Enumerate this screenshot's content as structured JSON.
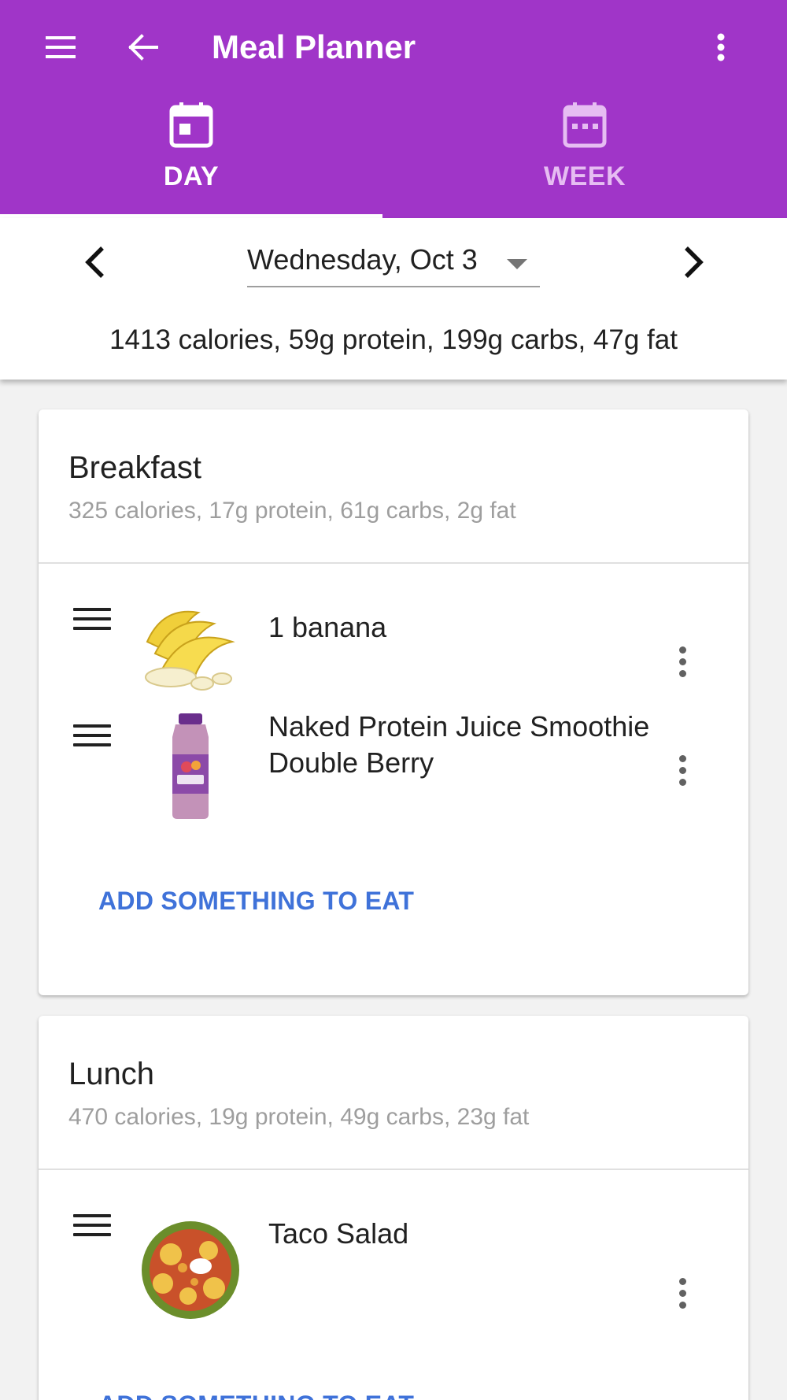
{
  "app_bar": {
    "title": "Meal Planner",
    "accent_color": "#a035c8"
  },
  "tabs": [
    {
      "label": "DAY",
      "icon": "calendar-day-icon",
      "selected": true
    },
    {
      "label": "WEEK",
      "icon": "calendar-week-icon",
      "selected": false
    }
  ],
  "date_nav": {
    "date": "Wednesday, Oct 3",
    "totals": "1413 calories, 59g protein, 199g carbs, 47g fat"
  },
  "meals": [
    {
      "title": "Breakfast",
      "totals": "325 calories, 17g protein, 61g carbs, 2g fat",
      "items": [
        {
          "name": "1 banana",
          "image": "banana"
        },
        {
          "name": "Naked Protein Juice Smoothie Double Berry",
          "image": "smoothie-bottle"
        }
      ],
      "add_label": "ADD SOMETHING TO EAT"
    },
    {
      "title": "Lunch",
      "totals": "470 calories, 19g protein, 49g carbs, 23g fat",
      "items": [
        {
          "name": "Taco Salad",
          "image": "taco-salad"
        }
      ],
      "add_label": "ADD SOMETHING TO EAT"
    }
  ]
}
